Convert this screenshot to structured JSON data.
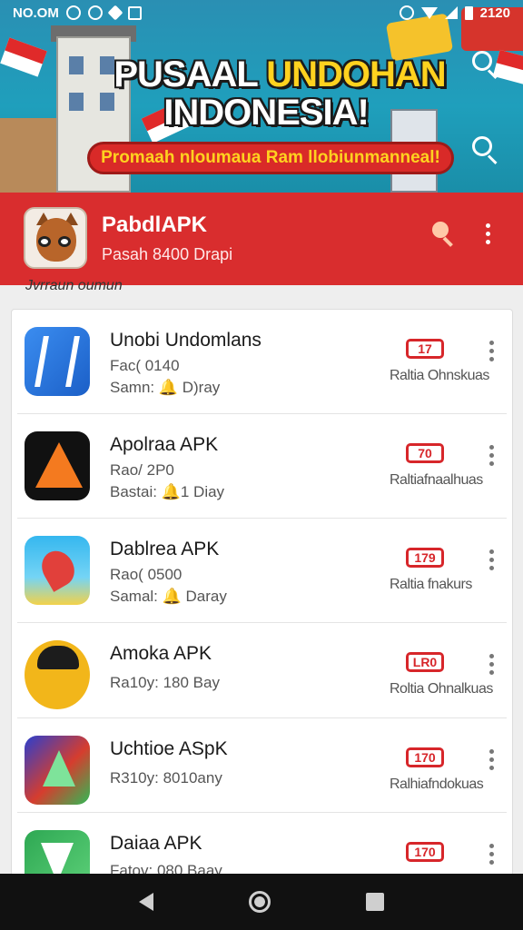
{
  "status_bar": {
    "left_text": "NO.OM",
    "right_text": "2120"
  },
  "banner": {
    "title_part1": "PUSAAL ",
    "title_part2": "UNDOHAN",
    "title_line2": "INDONESIA!",
    "ribbon": "Promaah nloumaua Ram llobiunmanneal!"
  },
  "app_header": {
    "title": "PabdlAPK",
    "subtitle": "Pasah 8400 Drapi"
  },
  "section_caption": "Jvrraun oumun",
  "apps": [
    {
      "name": "Unobi Undomlans",
      "meta1": "Fac( 0140",
      "meta2": "Samn: 🔔 D)ray",
      "badge": "17",
      "status": "Raltia Ohnskuas",
      "icon": "app-a-icon"
    },
    {
      "name": "Apolraa APK",
      "meta1": "Rao/ 2P0",
      "meta2": "Bastai: 🔔1 Diay",
      "badge": "70",
      "status": "Raltiafnaalhuas",
      "icon": "app-p-icon"
    },
    {
      "name": "Dablrea APK",
      "meta1": "Rao( 0500",
      "meta2": "Samal: 🔔 Daray",
      "badge": "179",
      "status": "Raltia fnakurs",
      "icon": "app-map-icon"
    },
    {
      "name": "Amoka APK",
      "meta1": "Ra10y: 180 Bay",
      "meta2": "",
      "badge": "LR0",
      "status": "Roltia Ohnalkuas",
      "icon": "app-face-icon"
    },
    {
      "name": "Uchtioe ASpK",
      "meta1": "R310y: 8010any",
      "meta2": "",
      "badge": "170",
      "status": "Ralhiafndokuas",
      "icon": "app-play-icon"
    },
    {
      "name": "Daiaa APK",
      "meta1": "Fatov: 080 Baay",
      "meta2": "",
      "badge": "170",
      "status": "",
      "icon": "app-green-icon"
    }
  ]
}
